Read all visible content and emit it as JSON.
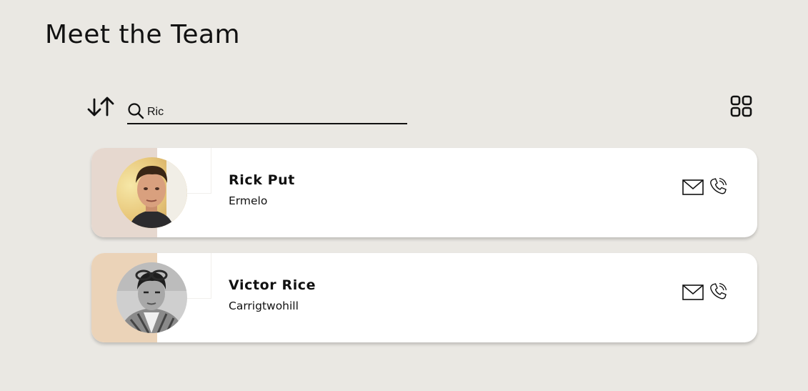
{
  "page": {
    "title": "Meet the Team"
  },
  "toolbar": {
    "sort_icon": "sort-arrows-icon",
    "search_icon": "search-icon",
    "search_value": "Ric",
    "view_toggle_icon": "grid-view-icon"
  },
  "members": [
    {
      "name": "Rick Put",
      "city": "Ermelo",
      "accent_color": "#e6d8cf",
      "avatar_style": "color-photo",
      "contact_icons": [
        "mail-icon",
        "phone-icon"
      ]
    },
    {
      "name": "Victor Rice",
      "city": "Carrigtwohill",
      "accent_color": "#ebd3b8",
      "avatar_style": "grayscale-photo",
      "contact_icons": [
        "mail-icon",
        "phone-icon"
      ]
    }
  ],
  "colors": {
    "background": "#eae8e3",
    "card": "#ffffff",
    "text": "#111111"
  }
}
